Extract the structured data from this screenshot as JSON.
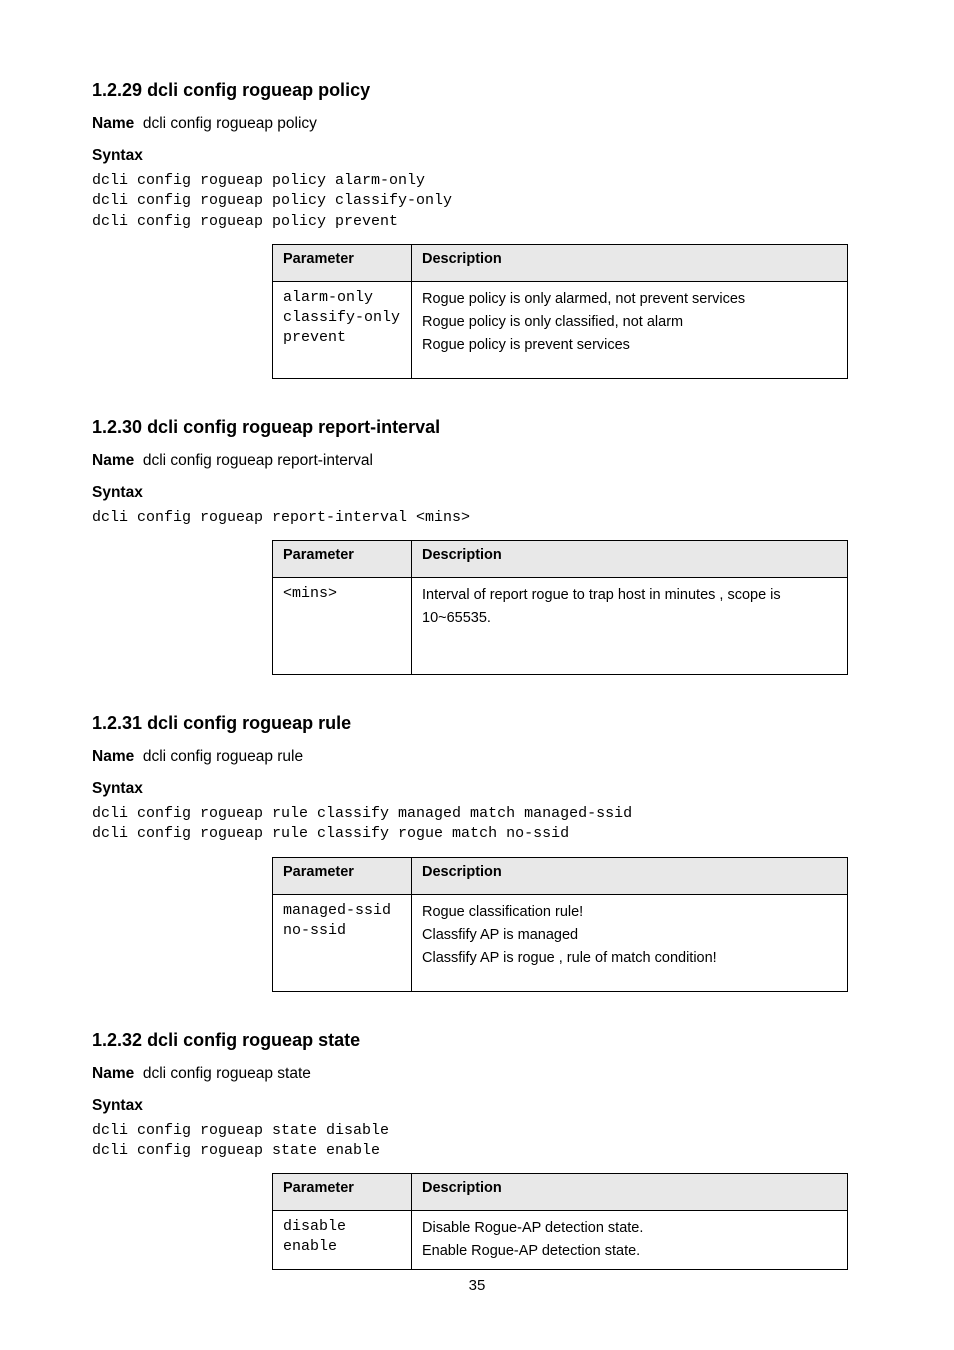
{
  "sections": [
    {
      "number": "1.2.29",
      "title": "dcli config rogueap policy",
      "name_label": "Name",
      "name": "dcli config rogueap policy",
      "syntax_label": "Syntax",
      "syntax": "dcli config rogueap policy alarm-only\ndcli config rogueap policy classify-only\ndcli config rogueap policy prevent",
      "table": {
        "headers": [
          "Parameter",
          "Description"
        ],
        "rows": [
          {
            "param": "alarm-only\nclassify-only\nprevent",
            "desc": "Rogue policy is only alarmed, not prevent services\nRogue policy is only classified, not alarm\nRogue policy is prevent services"
          }
        ]
      }
    },
    {
      "number": "1.2.30",
      "title": "dcli config rogueap report-interval",
      "name_label": "Name",
      "name": "dcli config rogueap report-interval",
      "syntax_label": "Syntax",
      "syntax": "dcli config rogueap report-interval <mins>",
      "table": {
        "headers": [
          "Parameter",
          "Description"
        ],
        "rows": [
          {
            "param": "<mins>",
            "desc": "Interval of report rogue to trap host in minutes , scope is 10~65535."
          }
        ]
      }
    },
    {
      "number": "1.2.31",
      "title": "dcli config rogueap rule",
      "name_label": "Name",
      "name": "dcli config rogueap rule",
      "syntax_label": "Syntax",
      "syntax": "dcli config rogueap rule classify managed match managed-ssid\ndcli config rogueap rule classify rogue match no-ssid",
      "table": {
        "headers": [
          "Parameter",
          "Description"
        ],
        "rows": [
          {
            "param": "managed-ssid\nno-ssid",
            "desc": "Rogue classification rule!\nClassfify AP is managed\nClassfify AP is rogue , rule of match condition!"
          }
        ]
      }
    },
    {
      "number": "1.2.32",
      "title": "dcli config rogueap state",
      "name_label": "Name",
      "name": "dcli config rogueap state",
      "syntax_label": "Syntax",
      "syntax": "dcli config rogueap state disable\ndcli config rogueap state enable",
      "table": {
        "headers": [
          "Parameter",
          "Description"
        ],
        "rows": [
          {
            "param": "disable\nenable",
            "desc": "Disable Rogue-AP detection state.\nEnable Rogue-AP detection state."
          }
        ]
      }
    }
  ],
  "page_number": "35"
}
